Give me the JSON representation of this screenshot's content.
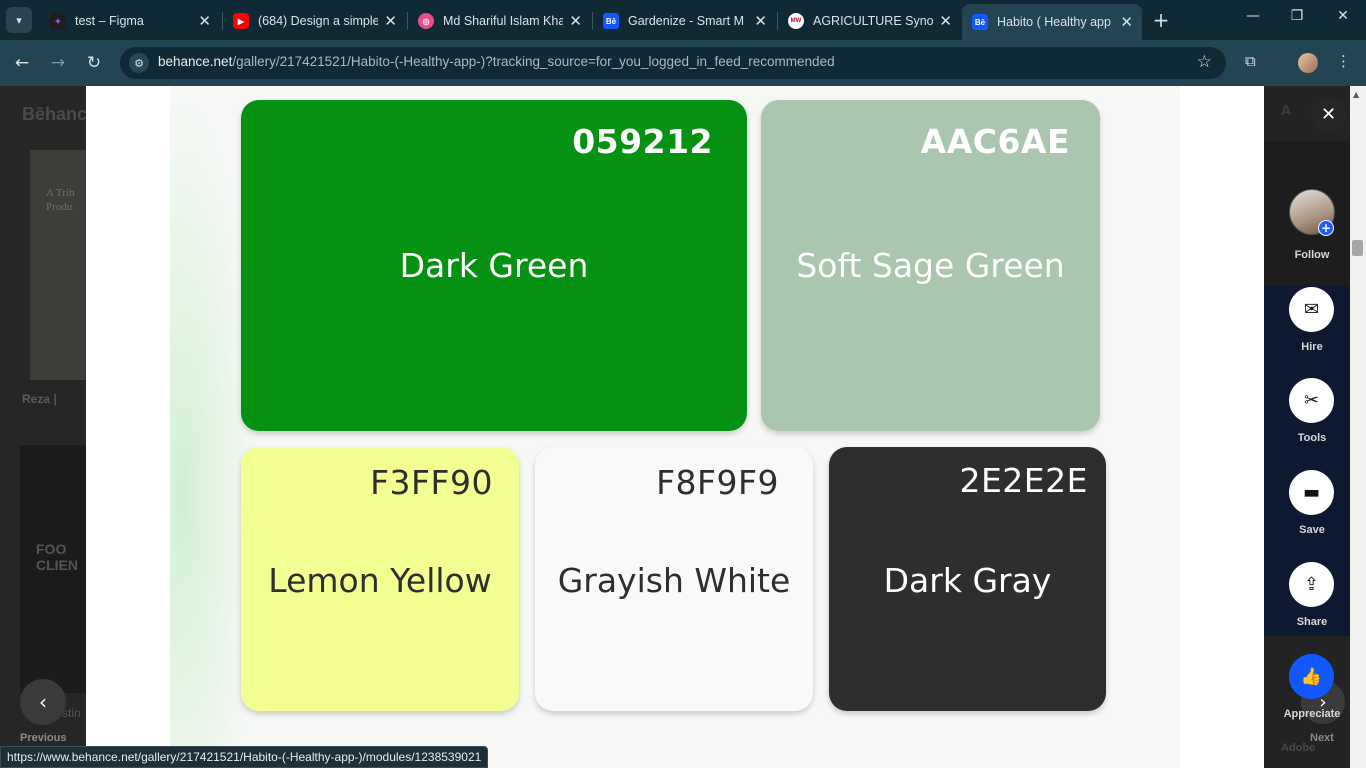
{
  "browser": {
    "tabs": [
      {
        "title": "test – Figma",
        "favicon_color": "#a259ff",
        "icon": "figma-icon"
      },
      {
        "title": "(684) Design a simple",
        "favicon_color": "#ff0000",
        "icon": "youtube-icon"
      },
      {
        "title": "Md Shariful Islam Kha",
        "favicon_color": "#ea4c89",
        "icon": "dribbble-icon"
      },
      {
        "title": "Gardenize - Smart M",
        "favicon_color": "#1357ff",
        "icon": "behance-icon"
      },
      {
        "title": "AGRICULTURE Synony",
        "favicon_color": "#ffffff",
        "icon": "merriam-webster-icon"
      },
      {
        "title": "Habito ( Healthy app",
        "favicon_color": "#1357ff",
        "icon": "behance-icon"
      }
    ],
    "behance_fav": "Bē",
    "mw_fav": "MW",
    "url_host": "behance.net",
    "url_path": "/gallery/217421521/Habito-(-Healthy-app-)?tracking_source=for_you_logged_in_feed_recommended",
    "status_url": "https://www.behance.net/gallery/217421521/Habito-(-Healthy-app-)/modules/1238539021"
  },
  "background_page": {
    "logo": "Bēhance",
    "thumb1_text": "A Trib\nProdu",
    "user1": "Reza |",
    "thumb2_text": "FOO\nCLIEN",
    "user2": "stin",
    "previous_label": "Previous",
    "next_label": "Next",
    "adobe_label": "Adobe"
  },
  "palette": [
    {
      "code": "059212",
      "name": "Dark Green",
      "color": "#059212",
      "text_color": "#ffffff"
    },
    {
      "code": "AAC6AE",
      "name": "Soft Sage Green",
      "color": "#aac6ae",
      "text_color": "#ffffff"
    },
    {
      "code": "F3FF90",
      "name": "Lemon Yellow",
      "color": "#f3ff90",
      "text_color": "#2e2e2e"
    },
    {
      "code": "F8F9F9",
      "name": "Grayish White",
      "color": "#f8f9f9",
      "text_color": "#2e2e2e"
    },
    {
      "code": "2E2E2E",
      "name": "Dark Gray",
      "color": "#2e2e2e",
      "text_color": "#ffffff"
    }
  ],
  "actions": {
    "follow": "Follow",
    "hire": "Hire",
    "tools": "Tools",
    "save": "Save",
    "share": "Share",
    "appreciate": "Appreciate"
  }
}
